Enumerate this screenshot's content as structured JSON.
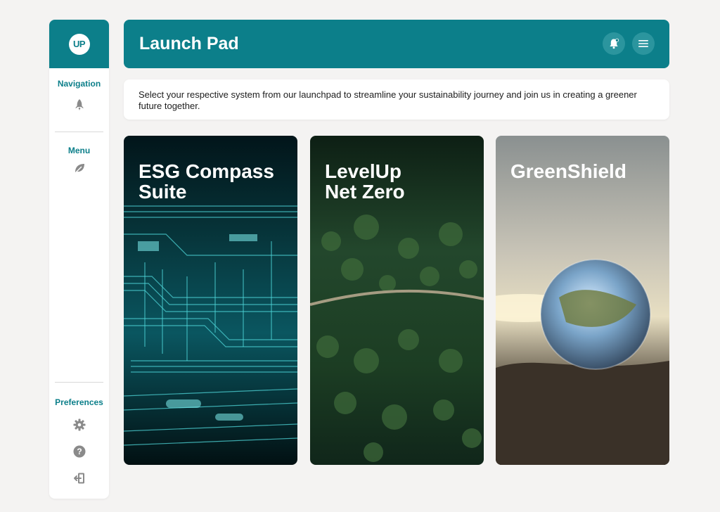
{
  "sidebar": {
    "logo_text": "UP",
    "navigation": {
      "title": "Navigation",
      "icon": "rocket-icon"
    },
    "menu": {
      "title": "Menu",
      "icon": "leaf-icon"
    },
    "preferences": {
      "title": "Preferences",
      "icons": [
        "gear-icon",
        "help-icon",
        "logout-icon"
      ]
    }
  },
  "header": {
    "title": "Launch Pad",
    "buttons": [
      "notification-bell-icon",
      "hamburger-menu-icon"
    ]
  },
  "intro": {
    "text": "Select your respective system from our launchpad to streamline your sustainability journey and join us in creating a greener future together."
  },
  "cards": [
    {
      "title": "ESG Compass\nSuite",
      "image": "circuit-board"
    },
    {
      "title": "LevelUp\nNet Zero",
      "image": "aerial-forest-road"
    },
    {
      "title": "GreenShield",
      "image": "crystal-globe-on-rock"
    }
  ],
  "colors": {
    "brand": "#0c7f8a",
    "background": "#f4f3f2",
    "icon_gray": "#8a8a8a"
  }
}
